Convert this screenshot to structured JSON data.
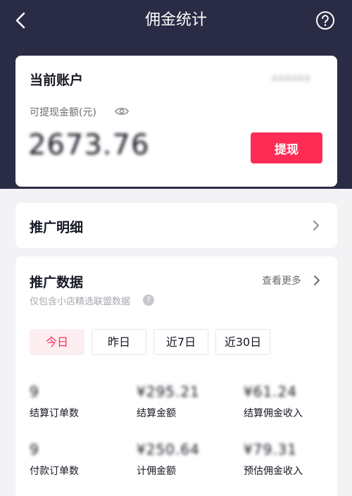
{
  "nav": {
    "title": "佣金统计",
    "back_icon": "chevron-left-icon",
    "help_icon": "question-circle-icon"
  },
  "account": {
    "title": "当前账户",
    "id_masked": "xxxxxx",
    "withdrawable_label": "可提现金额(元)",
    "balance": "2673.76",
    "withdraw_button": "提现"
  },
  "promo_detail": {
    "title": "推广明细"
  },
  "promo_data": {
    "title": "推广数据",
    "more_label": "查看更多",
    "subtitle": "仅包含小店精选联盟数据",
    "tabs": [
      {
        "label": "今日",
        "active": true
      },
      {
        "label": "昨日",
        "active": false
      },
      {
        "label": "近7日",
        "active": false
      },
      {
        "label": "近30日",
        "active": false
      }
    ],
    "stats": [
      {
        "value": "9",
        "label": "结算订单数"
      },
      {
        "value": "¥295.21",
        "label": "结算金额"
      },
      {
        "value": "¥61.24",
        "label": "结算佣金收入"
      },
      {
        "value": "9",
        "label": "付款订单数"
      },
      {
        "value": "¥250.64",
        "label": "计佣金额"
      },
      {
        "value": "¥79.31",
        "label": "预估佣金收入"
      }
    ]
  },
  "colors": {
    "header_bg": "#2a2b45",
    "accent": "#fe2c55",
    "page_bg": "#f3f3f5"
  }
}
